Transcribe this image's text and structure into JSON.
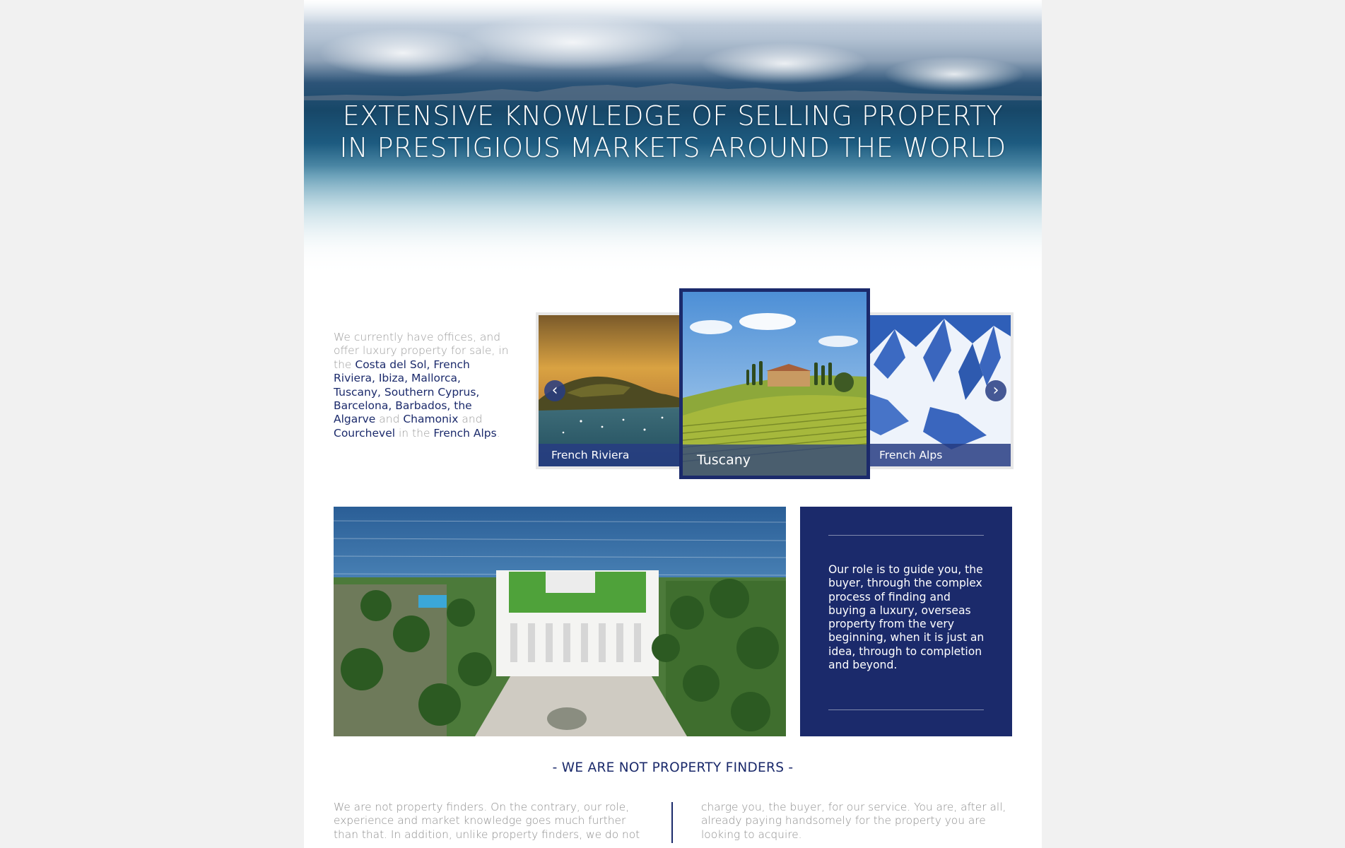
{
  "hero": {
    "title_line1": "EXTENSIVE KNOWLEDGE OF SELLING PROPERTY",
    "title_line2": "IN PRESTIGIOUS MARKETS AROUND THE WORLD"
  },
  "intro": {
    "lead": "We currently have offices, and offer luxury property for sale, in the ",
    "locations_main": "Costa del Sol, French Riviera, Ibiza, Mallorca, Tuscany, Southern Cyprus, Barcelona, Barbados, the Algarve",
    "and1": " and ",
    "chamonix": "Chamonix",
    "and2": " and ",
    "courchevel": "Courchevel",
    "in_the": " in the ",
    "french_alps": "French Alps",
    "period": "."
  },
  "carousel": {
    "prev_icon": "chevron-left-icon",
    "next_icon": "chevron-right-icon",
    "prev_glyph": "‹",
    "next_glyph": "›",
    "items": [
      {
        "label": "French Riviera"
      },
      {
        "label": "Tuscany"
      },
      {
        "label": "French Alps"
      }
    ],
    "active_index": 1
  },
  "role": {
    "text": "Our role is to guide you, the buyer, through the complex process of finding and buying a luxury, overseas property from the very beginning, when it is just an idea, through to completion and beyond."
  },
  "not_finders": {
    "title": "- WE ARE NOT PROPERTY FINDERS -",
    "col_left": "We are not property finders.  On the contrary, our role, experience and market knowledge goes much further than that.  In addition, unlike property finders, we do not",
    "col_right": "charge you, the buyer, for our service.  You are, after all, already paying handsomely for the property you are looking to acquire."
  },
  "colors": {
    "brand_navy": "#1b2a6b",
    "caption_blue": "#273c82",
    "body_gray": "#8e8e8e"
  }
}
